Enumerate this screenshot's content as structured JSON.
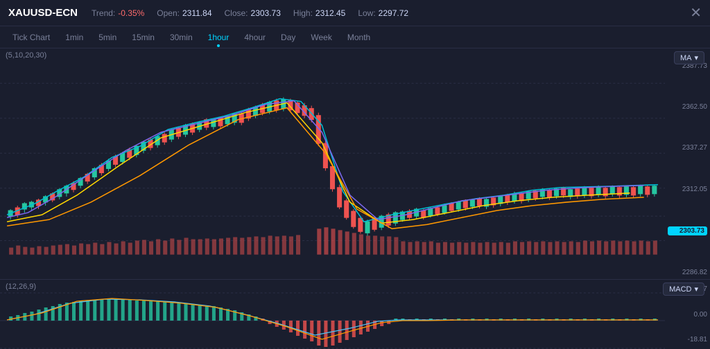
{
  "header": {
    "symbol": "XAUUSD-ECN",
    "trend_label": "Trend:",
    "trend_value": "-0.35%",
    "open_label": "Open:",
    "open_value": "2311.84",
    "close_label": "Close:",
    "close_value": "2303.73",
    "high_label": "High:",
    "high_value": "2312.45",
    "low_label": "Low:",
    "low_value": "2297.72"
  },
  "timeframes": [
    {
      "id": "tick",
      "label": "Tick Chart",
      "active": false
    },
    {
      "id": "1min",
      "label": "1min",
      "active": false
    },
    {
      "id": "5min",
      "label": "5min",
      "active": false
    },
    {
      "id": "15min",
      "label": "15min",
      "active": false
    },
    {
      "id": "30min",
      "label": "30min",
      "active": false
    },
    {
      "id": "1hour",
      "label": "1hour",
      "active": true
    },
    {
      "id": "4hour",
      "label": "4hour",
      "active": false
    },
    {
      "id": "day",
      "label": "Day",
      "active": false
    },
    {
      "id": "week",
      "label": "Week",
      "active": false
    },
    {
      "id": "month",
      "label": "Month",
      "active": false
    }
  ],
  "main_chart": {
    "panel_label": "(5,10,20,30)",
    "ma_selector": "MA",
    "price_levels": [
      "2387.73",
      "2362.50",
      "2337.27",
      "2312.05",
      "2303.73",
      "2286.82"
    ],
    "current_price": "2303.73"
  },
  "macd_panel": {
    "panel_label": "(12,26,9)",
    "selector": "MACD",
    "levels": [
      "8.57",
      "0.00",
      "-18.81"
    ]
  },
  "colors": {
    "bg": "#1a1e2e",
    "accent": "#00d4ff",
    "up": "#26c6a0",
    "down": "#ef5350",
    "grid": "#2a2e45"
  }
}
